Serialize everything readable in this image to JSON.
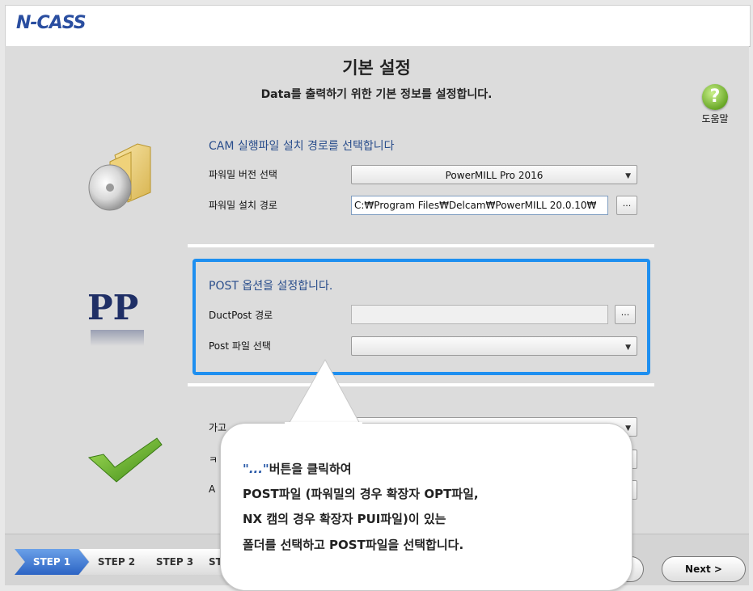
{
  "app": {
    "logo_text": "N-CASS"
  },
  "header": {
    "title": "기본 설정",
    "subtitle": "Data를 출력하기 위한 기본 정보를 설정합니다."
  },
  "help": {
    "icon": "question-icon",
    "label": "도움말"
  },
  "cam_section": {
    "title": "CAM 실행파일 설치 경로를 선택합니다",
    "version_label": "파워밀 버전 선택",
    "version_value": "PowerMILL Pro 2016",
    "path_label": "파워밀 설치 경로",
    "path_value": "C:₩Program Files₩Delcam₩PowerMILL 20.0.10₩",
    "browse_label": "..."
  },
  "post_section": {
    "pp_text": "PP",
    "title": "POST 옵션을 설정합니다.",
    "ductpost_label": "DuctPost 경로",
    "ductpost_value": "",
    "browse_label": "...",
    "post_file_label": "Post 파일 선택",
    "post_file_value": ""
  },
  "third_section": {
    "row1_label_partial": "가고",
    "row2_label_partial": "ㅋ",
    "row3_label_partial": "A"
  },
  "callout": {
    "quote_open": "\"...\"",
    "line1_rest": "버튼을 클릭하여",
    "line2": "POST파일 (파워밀의 경우 확장자 OPT파일,",
    "line3": "NX 캠의 경우 확장자 PUI파일)이 있는",
    "line4": "폴더를 선택하고 POST파일을 선택합니다."
  },
  "steps": [
    {
      "label": "STEP 1",
      "active": true
    },
    {
      "label": "STEP 2",
      "active": false
    },
    {
      "label": "STEP 3",
      "active": false
    },
    {
      "label": "ST",
      "active": false
    }
  ],
  "nav": {
    "next_label": "Next >"
  },
  "colors": {
    "highlight": "#1e8ff0",
    "section_title": "#2a4e8c",
    "step_active": "#2c64c4"
  }
}
